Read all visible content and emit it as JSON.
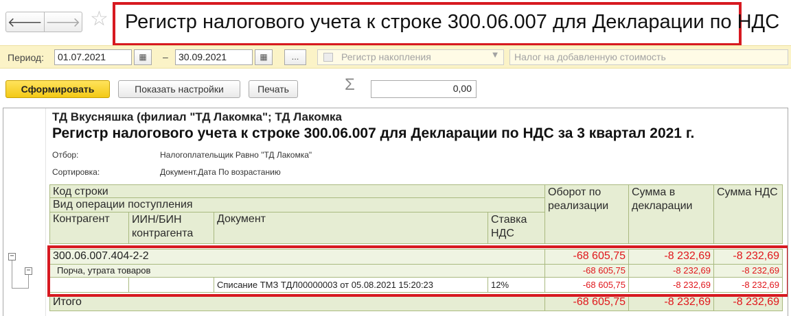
{
  "window": {
    "title": "Регистр налогового учета к строке 300.06.007 для Декларации по НДС",
    "back_glyph": "🡐",
    "forward_glyph": "🡒",
    "star_glyph": "☆"
  },
  "period": {
    "label": "Период:",
    "from": "01.07.2021",
    "to": "30.09.2021",
    "dash": "–",
    "dots": "...",
    "calendar_glyph": "▦",
    "register_placeholder": "Регистр накопления",
    "tax_placeholder": "Налог на добавленную стоимость"
  },
  "toolbar": {
    "generate_label": "Сформировать",
    "settings_label": "Показать настройки",
    "print_label": "Печать",
    "sigma": "Σ",
    "sum_value": "0,00"
  },
  "report": {
    "organization": "ТД Вкусняшка (филиал \"ТД Лакомка\"; ТД Лакомка",
    "title": "Регистр налогового учета к строке 300.06.007 для Декларации по НДС  за 3 квартал 2021 г.",
    "filter_label": "Отбор:",
    "filter_value": "Налогоплательщик Равно \"ТД Лакомка\"",
    "sort_label": "Сортировка:",
    "sort_value": "Документ.Дата По возрастанию",
    "headers": {
      "line_code": "Код строки",
      "operation_type": "Вид операции поступления",
      "counterparty": "Контрагент",
      "iin_bin": "ИИН/БИН контрагента",
      "document": "Документ",
      "vat_rate": "Ставка НДС",
      "sales_turnover": "Оборот по реализации",
      "declared_amount": "Сумма в декларации",
      "vat_amount": "Сумма НДС"
    },
    "group_row": {
      "code": "300.06.007.404-2-2",
      "turnover": "-68 605,75",
      "declared": "-8 232,69",
      "vat": "-8 232,69"
    },
    "operation_row": {
      "label": "Порча, утрата товаров",
      "turnover": "-68 605,75",
      "declared": "-8 232,69",
      "vat": "-8 232,69"
    },
    "detail_row": {
      "counterparty": "",
      "iin_bin": "",
      "document": "Списание ТМЗ ТДЛ00000003 от 05.08.2021 15:20:23",
      "rate": "12%",
      "turnover": "-68 605,75",
      "declared": "-8 232,69",
      "vat": "-8 232,69"
    },
    "total_row": {
      "label": "Итого",
      "turnover": "-68 605,75",
      "declared": "-8 232,69",
      "vat": "-8 232,69"
    }
  },
  "colors": {
    "highlight_red": "#d71920",
    "negative_red": "#e0161b",
    "header_green": "#e6edd3",
    "period_yellow": "#fbf3c7",
    "primary_button_yellow": "#f3c916"
  }
}
